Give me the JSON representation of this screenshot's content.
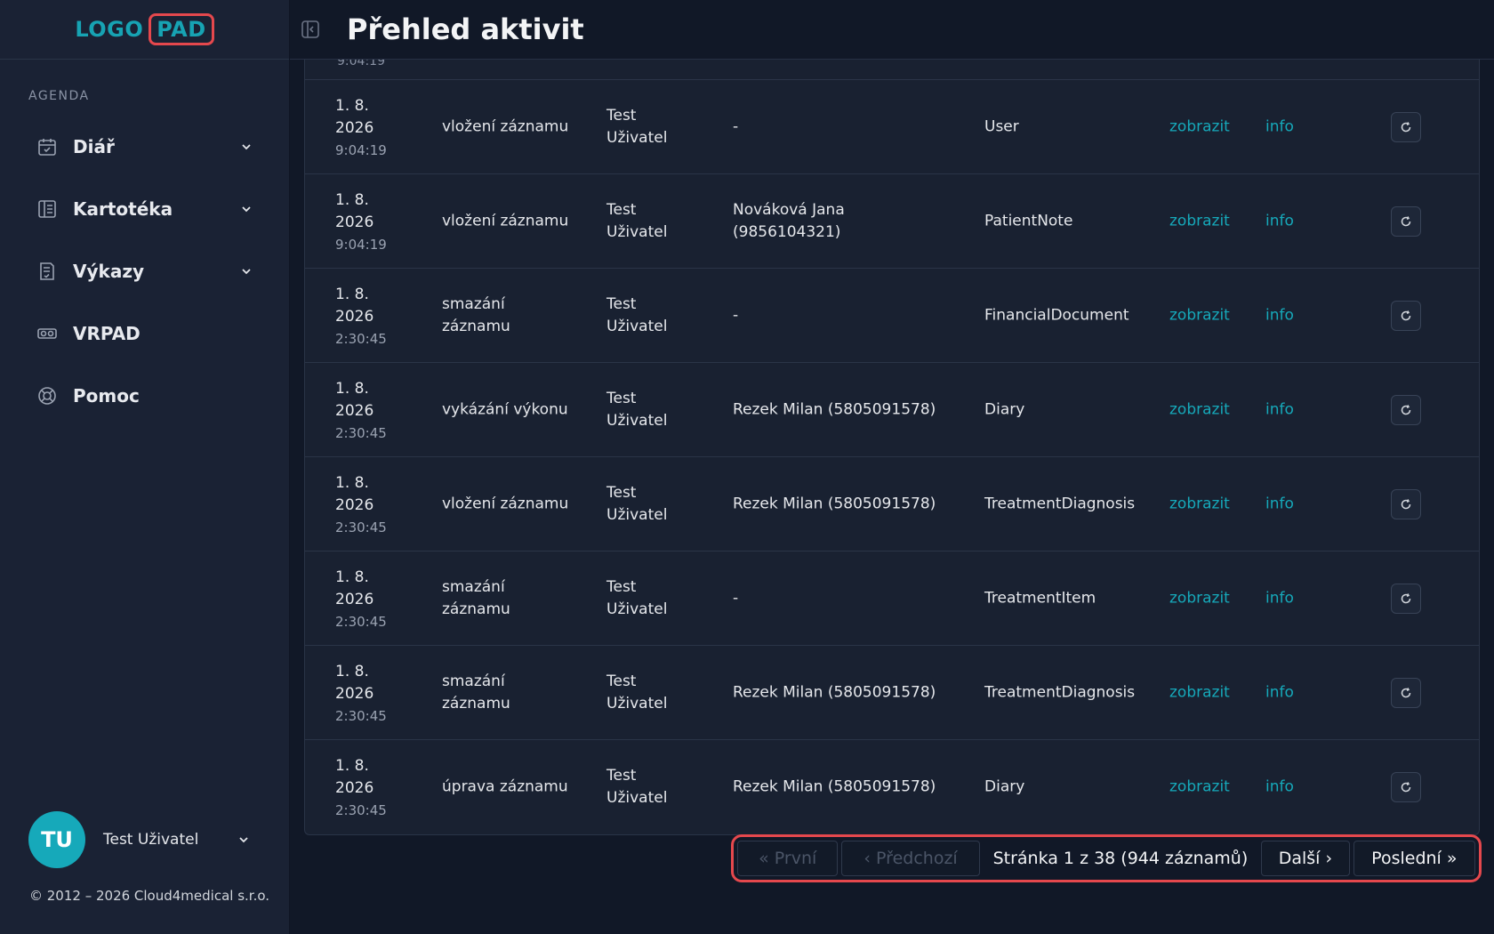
{
  "logo": {
    "part1": "LOGO",
    "part2": "PAD"
  },
  "sidebar": {
    "section_label": "AGENDA",
    "items": [
      {
        "label": "Diář",
        "icon": "calendar-check-icon",
        "expandable": true
      },
      {
        "label": "Kartotéka",
        "icon": "card-file-icon",
        "expandable": true
      },
      {
        "label": "Výkazy",
        "icon": "report-icon",
        "expandable": true
      },
      {
        "label": "VRPAD",
        "icon": "vr-headset-icon",
        "expandable": false
      },
      {
        "label": "Pomoc",
        "icon": "lifebuoy-icon",
        "expandable": false
      }
    ],
    "user": {
      "initials": "TU",
      "name": "Test Uživatel"
    },
    "copyright": "© 2012 – 2026 Cloud4medical s.r.o."
  },
  "header": {
    "title": "Přehled aktivit"
  },
  "table": {
    "partial_row_time": "9:04:19",
    "rows": [
      {
        "date": "1. 8.",
        "year": "2026",
        "time": "9:04:19",
        "action": "vložení záznamu",
        "user": "Test Uživatel",
        "patient": "-",
        "entity": "User",
        "view": "zobrazit",
        "info": "info"
      },
      {
        "date": "1. 8.",
        "year": "2026",
        "time": "9:04:19",
        "action": "vložení záznamu",
        "user": "Test Uživatel",
        "patient": "Nováková Jana (9856104321)",
        "entity": "PatientNote",
        "view": "zobrazit",
        "info": "info"
      },
      {
        "date": "1. 8.",
        "year": "2026",
        "time": "2:30:45",
        "action": "smazání záznamu",
        "user": "Test Uživatel",
        "patient": "-",
        "entity": "FinancialDocument",
        "view": "zobrazit",
        "info": "info"
      },
      {
        "date": "1. 8.",
        "year": "2026",
        "time": "2:30:45",
        "action": "vykázání výkonu",
        "user": "Test Uživatel",
        "patient": "Rezek Milan (5805091578)",
        "entity": "Diary",
        "view": "zobrazit",
        "info": "info"
      },
      {
        "date": "1. 8.",
        "year": "2026",
        "time": "2:30:45",
        "action": "vložení záznamu",
        "user": "Test Uživatel",
        "patient": "Rezek Milan (5805091578)",
        "entity": "TreatmentDiagnosis",
        "view": "zobrazit",
        "info": "info"
      },
      {
        "date": "1. 8.",
        "year": "2026",
        "time": "2:30:45",
        "action": "smazání záznamu",
        "user": "Test Uživatel",
        "patient": "-",
        "entity": "TreatmentItem",
        "view": "zobrazit",
        "info": "info"
      },
      {
        "date": "1. 8.",
        "year": "2026",
        "time": "2:30:45",
        "action": "smazání záznamu",
        "user": "Test Uživatel",
        "patient": "Rezek Milan (5805091578)",
        "entity": "TreatmentDiagnosis",
        "view": "zobrazit",
        "info": "info"
      },
      {
        "date": "1. 8.",
        "year": "2026",
        "time": "2:30:45",
        "action": "úprava záznamu",
        "user": "Test Uživatel",
        "patient": "Rezek Milan (5805091578)",
        "entity": "Diary",
        "view": "zobrazit",
        "info": "info"
      }
    ]
  },
  "pagination": {
    "first": "« První",
    "prev": "‹ Předchozí",
    "info": "Stránka 1 z 38 (944 záznamů)",
    "next": "Další ›",
    "last": "Poslední »"
  },
  "colors": {
    "accent": "#16a9ba",
    "highlight": "#e5484d",
    "background": "#111827",
    "sidebar": "#1a2234"
  }
}
